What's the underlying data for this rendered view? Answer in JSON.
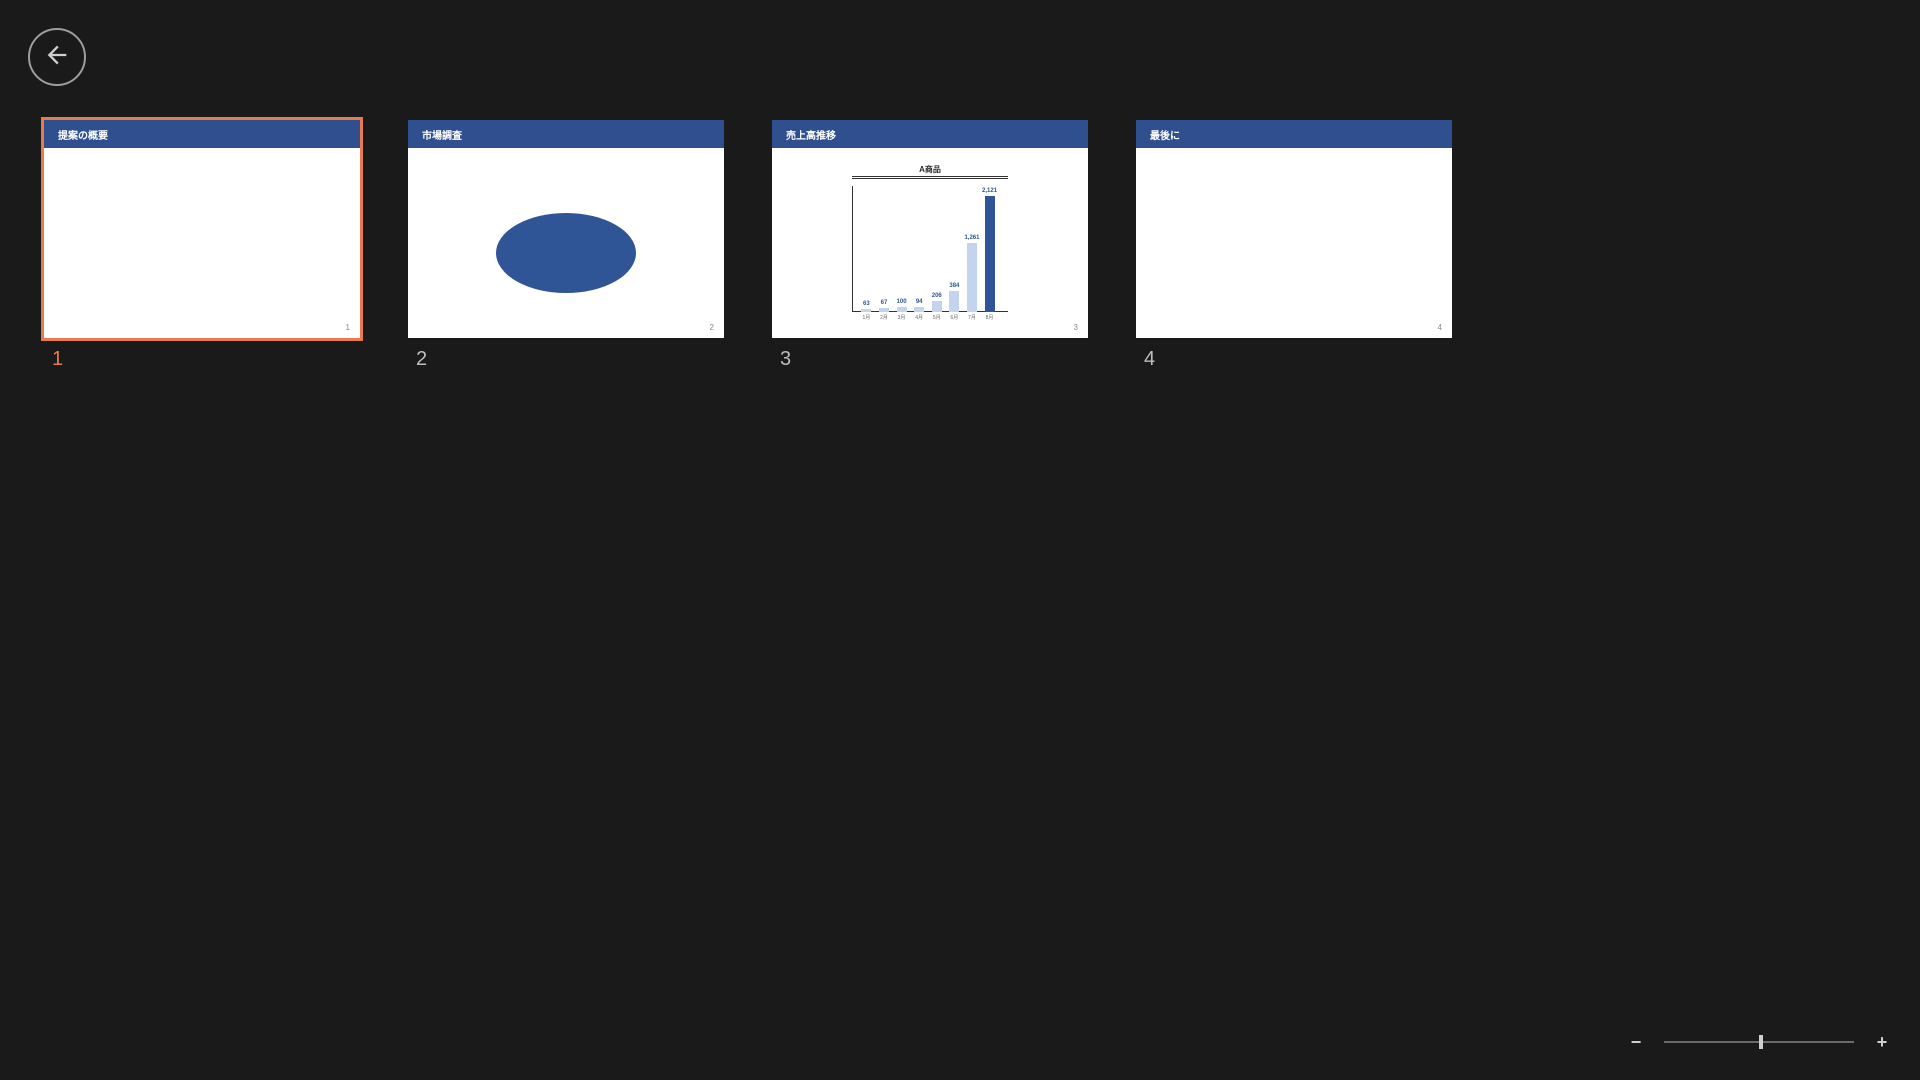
{
  "back_label": "Back",
  "slides": [
    {
      "index": "1",
      "title": "提案の概要",
      "page": "1",
      "selected": true,
      "kind": "blank"
    },
    {
      "index": "2",
      "title": "市場調査",
      "page": "2",
      "selected": false,
      "kind": "ellipse"
    },
    {
      "index": "3",
      "title": "売上高推移",
      "page": "3",
      "selected": false,
      "kind": "chart"
    },
    {
      "index": "4",
      "title": "最後に",
      "page": "4",
      "selected": false,
      "kind": "blank"
    }
  ],
  "chart_data": {
    "type": "bar",
    "title": "A商品",
    "xlabel": "",
    "ylabel": "",
    "ylim": [
      0,
      2200
    ],
    "categories": [
      "1月",
      "2月",
      "3月",
      "4月",
      "5月",
      "6月",
      "7月",
      "8月"
    ],
    "values": [
      63,
      67,
      100,
      94,
      206,
      384,
      1261,
      2121
    ],
    "highlight_index": 7
  },
  "zoom": {
    "minus": "−",
    "plus": "+",
    "value_percent": 50
  }
}
